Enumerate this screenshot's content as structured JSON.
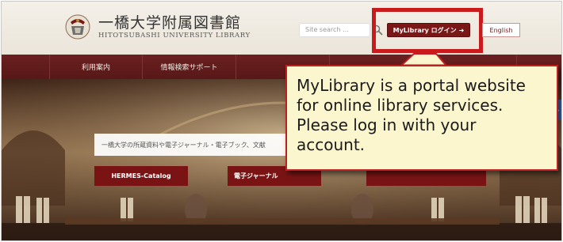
{
  "header": {
    "brand_jp": "一橋大学附属図書館",
    "brand_en": "HITOTSUBASHI UNIVERSITY LIBRARY",
    "search_placeholder": "Site search ...",
    "mylibrary_label": "MyLibrary ログイン",
    "english_label": "English"
  },
  "nav": {
    "items": [
      "利用案内",
      "情報検索サポート",
      "",
      "",
      ""
    ]
  },
  "hero": {
    "search_placeholder": "一橋大学の所蔵資料や電子ジャーナル・電子ブック、文献",
    "buttons": [
      "HERMES-Catalog",
      "電子ジャーナル",
      ""
    ]
  },
  "callout": {
    "text": "MyLibrary is a portal website for online library services. Please log in with your account."
  },
  "colors": {
    "brand_maroon": "#7a1717",
    "highlight_red": "#c91b1b",
    "callout_bg": "#fcf6cf"
  }
}
